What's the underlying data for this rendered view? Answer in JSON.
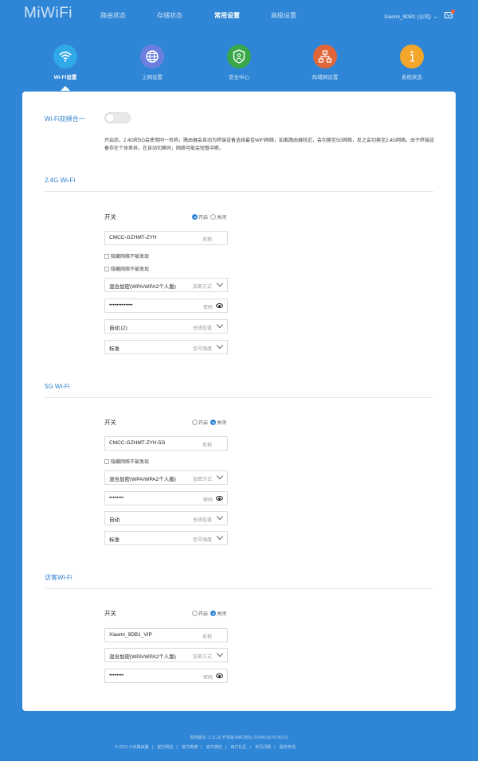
{
  "header": {
    "logo": "MiWiFi",
    "nav": [
      {
        "label": "路由状态"
      },
      {
        "label": "存储状态"
      },
      {
        "label": "常用设置"
      },
      {
        "label": "高级设置"
      }
    ],
    "user": "Xiaomi_9DB1 (公司)"
  },
  "tabs": [
    {
      "label": "Wi-Fi设置",
      "color": "#2fa9e8",
      "icon": "wifi-icon"
    },
    {
      "label": "上网设置",
      "color": "#6a7fe0",
      "icon": "globe-icon"
    },
    {
      "label": "安全中心",
      "color": "#3aa84a",
      "icon": "shield-icon"
    },
    {
      "label": "局域网设置",
      "color": "#e0663a",
      "icon": "network-icon"
    },
    {
      "label": "系统状态",
      "color": "#f4a62a",
      "icon": "info-icon"
    }
  ],
  "dual_band": {
    "label": "Wi-Fi双频合一",
    "description": "开启后，2.4G和5G会使用同一名称，路由器会自动为终端设备选择最佳WiFi网络，如离路由器较近，会切换至5G网络，反之会切换至2.4G网络。由于终端设备存在个体差异，在自动切换时，网络可能会短暂中断。"
  },
  "wifi24": {
    "title": "2.4G Wi-Fi",
    "switch_label": "开关",
    "on_label": "开启",
    "off_label": "关闭",
    "name_value": "CMCC-GZHMT-ZYH",
    "name_hint": "名称",
    "hide_label": "隐藏网络不被发现",
    "hide_label_2": "隐藏网络不被发现",
    "encryption_value": "混合加密(WPA/WPA2个人版)",
    "encryption_hint": "加密方式",
    "password_value": "•••••••••••••",
    "password_hint": "密码",
    "channel_value": "自动 (2)",
    "channel_hint": "无线信道",
    "strength_value": "标准",
    "strength_hint": "信号强度"
  },
  "wifi5": {
    "title": "5G Wi-Fi",
    "switch_label": "开关",
    "on_label": "开启",
    "off_label": "关闭",
    "name_value": "CMCC-GZHMT-ZYH-5G",
    "name_hint": "名称",
    "hide_label": "隐藏网络不被发现",
    "encryption_value": "混合加密(WPA/WPA2个人版)",
    "encryption_hint": "加密方式",
    "password_value": "••••••••",
    "password_hint": "密码",
    "channel_value": "自动",
    "channel_hint": "无线信道",
    "strength_value": "标准",
    "strength_hint": "信号强度"
  },
  "guest": {
    "title": "访客Wi-Fi",
    "switch_label": "开关",
    "on_label": "开启",
    "off_label": "关闭",
    "name_value": "Xiaomi_9DB1_VIP",
    "name_hint": "名称",
    "encryption_value": "混合加密(WPA/WPA2个人版)",
    "encryption_hint": "加密方式",
    "password_value": "••••••••",
    "password_hint": "密码"
  },
  "footer": {
    "version": "系统版本: 2.11.20 开发版   MAC地址: F0:B4:29:F5:9D:01",
    "links": [
      "© 2015 小米路由器",
      "官方网站",
      "官方微博",
      "官方微信",
      "用户社区",
      "常见问题",
      "服务热线"
    ]
  }
}
